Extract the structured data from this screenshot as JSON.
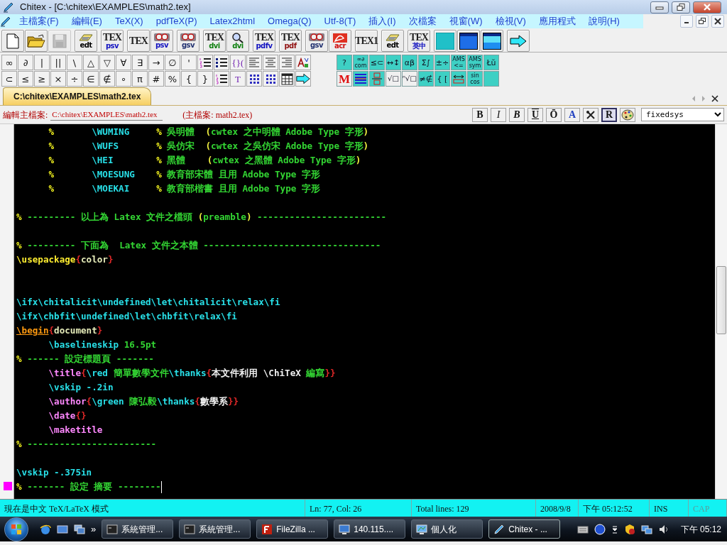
{
  "window": {
    "title": "Chitex - [C:\\chitex\\EXAMPLES\\math2.tex]"
  },
  "menu": [
    "主檔案(F)",
    "編輯(E)",
    "TeX(X)",
    "pdfTeX(P)",
    "Latex2html",
    "Omega(Q)",
    "Utf-8(T)",
    "插入(I)",
    "次檔案",
    "視窗(W)",
    "檢視(V)",
    "應用程式",
    "說明(H)"
  ],
  "toolbar": {
    "groups": [
      [
        {
          "kind": "new",
          "disabled": false
        },
        {
          "kind": "open",
          "disabled": false
        },
        {
          "kind": "save",
          "disabled": true
        }
      ],
      [
        {
          "kind": "notepad",
          "bottom": "edt",
          "color": "#000000",
          "disabled": false
        }
      ],
      [
        {
          "kind": "tex",
          "top": "TEX",
          "bottom": "psv",
          "color": "#1010c0",
          "disabled": false
        }
      ],
      [
        {
          "kind": "tex",
          "top": "TEX",
          "disabled": false
        },
        {
          "kind": "viewer",
          "bottom": "psv",
          "color": "#1010c0",
          "disabled": false
        }
      ],
      [
        {
          "kind": "viewer",
          "bottom": "gsv",
          "color": "#203070",
          "disabled": false
        }
      ],
      [
        {
          "kind": "tex",
          "top": "TEX",
          "bottom": "dvi",
          "color": "#108010",
          "disabled": false
        },
        {
          "kind": "magnifier",
          "bottom": "dvi",
          "color": "#108010",
          "disabled": false
        }
      ],
      [
        {
          "kind": "tex",
          "top": "TEX",
          "bottom": "pdfv",
          "color": "#1010c0",
          "disabled": false
        }
      ],
      [
        {
          "kind": "tex",
          "top": "TEX",
          "bottom": "pdf",
          "color": "#901010",
          "disabled": false
        }
      ],
      [
        {
          "kind": "viewer",
          "bottom": "gsv",
          "color": "#203070",
          "disabled": false
        },
        {
          "kind": "swirl",
          "bottom": "acr",
          "color": "#d01010",
          "disabled": false
        }
      ],
      [
        {
          "kind": "tex",
          "top": "TEX1",
          "disabled": false
        }
      ],
      [
        {
          "kind": "notepad",
          "bottom": "edt",
          "color": "#000000",
          "disabled": false
        }
      ],
      [
        {
          "kind": "tex",
          "top": "TEX",
          "bottom": "英中",
          "color": "#1010c0",
          "disabled": false
        }
      ],
      [
        {
          "kind": "square",
          "disabled": false
        },
        {
          "kind": "window",
          "disabled": false
        },
        {
          "kind": "window2",
          "disabled": false
        }
      ],
      [
        {
          "kind": "arrow",
          "disabled": false
        }
      ]
    ]
  },
  "symbols": {
    "rows": [
      [
        {
          "kind": "char",
          "text": "∞"
        },
        {
          "kind": "char",
          "text": "∂"
        },
        {
          "kind": "char",
          "text": "|"
        },
        {
          "kind": "char",
          "text": "||"
        },
        {
          "kind": "char",
          "text": "\\"
        },
        {
          "kind": "char",
          "text": "△"
        },
        {
          "kind": "char",
          "text": "▽"
        },
        {
          "kind": "char",
          "text": "∀"
        },
        {
          "kind": "char",
          "text": "∃"
        },
        {
          "kind": "char",
          "text": "→"
        },
        {
          "kind": "char",
          "text": "∅"
        },
        {
          "kind": "char",
          "text": "'"
        },
        {
          "kind": "numbered-list"
        },
        {
          "kind": "bullet-list"
        },
        {
          "kind": "bracket",
          "text": "{}("
        },
        {
          "kind": "align-left"
        },
        {
          "kind": "align-center"
        },
        {
          "kind": "align-right"
        },
        {
          "kind": "font-size"
        }
      ],
      [
        {
          "kind": "char",
          "text": "⊂"
        },
        {
          "kind": "char",
          "text": "≤"
        },
        {
          "kind": "char",
          "text": "≥"
        },
        {
          "kind": "char",
          "text": "×"
        },
        {
          "kind": "char",
          "text": "÷"
        },
        {
          "kind": "char",
          "text": "∈"
        },
        {
          "kind": "char",
          "text": "∉"
        },
        {
          "kind": "char",
          "text": "∘"
        },
        {
          "kind": "char",
          "text": "π"
        },
        {
          "kind": "char",
          "text": "#"
        },
        {
          "kind": "char",
          "text": "%"
        },
        {
          "kind": "char",
          "text": "{"
        },
        {
          "kind": "char",
          "text": "}"
        },
        {
          "kind": "numbered-list"
        },
        {
          "kind": "bracket",
          "text": "T"
        },
        {
          "kind": "grid"
        },
        {
          "kind": "grid"
        },
        {
          "kind": "table"
        },
        {
          "kind": "arrow"
        }
      ]
    ]
  },
  "math_palette": {
    "rows": [
      [
        {
          "kind": "math",
          "text": "?"
        },
        {
          "kind": "math",
          "lines": [
            "∞∂",
            "com"
          ]
        },
        {
          "kind": "math",
          "text": "≤⊂"
        },
        {
          "kind": "math",
          "text": "↔↕"
        },
        {
          "kind": "math",
          "text": "αβ"
        },
        {
          "kind": "math",
          "text": "Σ∫"
        },
        {
          "kind": "math",
          "text": "±÷"
        },
        {
          "kind": "math",
          "lines": [
            "AMS",
            "<="
          ]
        },
        {
          "kind": "math",
          "lines": [
            "AMS",
            "sym"
          ]
        },
        {
          "kind": "math",
          "text": "Łŭ"
        }
      ],
      [
        {
          "kind": "letter",
          "text": "M"
        },
        {
          "kind": "align-lines"
        },
        {
          "kind": "fraction"
        },
        {
          "kind": "plain",
          "text": "√□"
        },
        {
          "kind": "plain",
          "text": "ⁿ√□"
        },
        {
          "kind": "math",
          "text": "≠∉"
        },
        {
          "kind": "math",
          "text": "{ ["
        },
        {
          "kind": "hbox"
        },
        {
          "kind": "math",
          "lines": [
            "sin",
            "cos"
          ]
        },
        {
          "kind": "blank"
        }
      ]
    ]
  },
  "tabs": [
    {
      "label": "C:\\chitex\\EXAMPLES\\math2.tex",
      "selected": true
    }
  ],
  "file_bar": {
    "label": "編輯主檔案:",
    "path": "C:\\chitex\\EXAMPLES\\math2.tex",
    "main_file": "(主檔案: math2.tex)",
    "font": "fixedsys",
    "format_buttons": [
      {
        "kind": "bold",
        "text": "B",
        "pressed": false
      },
      {
        "kind": "italic",
        "text": "I",
        "pressed": false
      },
      {
        "kind": "bolditalic",
        "text": "B",
        "pressed": false
      },
      {
        "kind": "underline",
        "text": "U",
        "pressed": false
      },
      {
        "kind": "overline",
        "text": "Ō",
        "pressed": false
      },
      {
        "kind": "color",
        "text": "A",
        "pressed": false
      },
      {
        "kind": "tool",
        "pressed": false
      },
      {
        "kind": "raw",
        "text": "R",
        "pressed": true
      },
      {
        "kind": "palette",
        "pressed": false
      }
    ]
  },
  "editor": {
    "lines": [
      {
        "current": false,
        "segments": [
          {
            "kind": "pct",
            "text": "      %"
          },
          {
            "kind": "cmd",
            "text": "       \\WUMING"
          },
          {
            "kind": "pct",
            "text": "     %"
          },
          {
            "kind": "text",
            "text": " 吳明體  "
          },
          {
            "kind": "paren",
            "text": "("
          },
          {
            "kind": "text",
            "text": "cwtex 之中明體 Adobe Type 字形"
          },
          {
            "kind": "paren",
            "text": ")"
          }
        ]
      },
      {
        "current": false,
        "segments": [
          {
            "kind": "pct",
            "text": "      %"
          },
          {
            "kind": "cmd",
            "text": "       \\WUFS"
          },
          {
            "kind": "pct",
            "text": "       %"
          },
          {
            "kind": "text",
            "text": " 吳仿宋  "
          },
          {
            "kind": "paren",
            "text": "("
          },
          {
            "kind": "text",
            "text": "cwtex 之吳仿宋 Adobe Type 字形"
          },
          {
            "kind": "paren",
            "text": ")"
          }
        ]
      },
      {
        "current": false,
        "segments": [
          {
            "kind": "pct",
            "text": "      %"
          },
          {
            "kind": "cmd",
            "text": "       \\HEI"
          },
          {
            "kind": "pct",
            "text": "        %"
          },
          {
            "kind": "text",
            "text": " 黑體    "
          },
          {
            "kind": "paren",
            "text": "("
          },
          {
            "kind": "text",
            "text": "cwtex 之黑體 Adobe Type 字形"
          },
          {
            "kind": "paren",
            "text": ")"
          }
        ]
      },
      {
        "current": false,
        "segments": [
          {
            "kind": "pct",
            "text": "      %"
          },
          {
            "kind": "cmd",
            "text": "       \\MOESUNG"
          },
          {
            "kind": "pct",
            "text": "    %"
          },
          {
            "kind": "text",
            "text": " 教育部宋體 且用 Adobe Type 字形"
          }
        ]
      },
      {
        "current": false,
        "segments": [
          {
            "kind": "pct",
            "text": "      %"
          },
          {
            "kind": "cmd",
            "text": "       \\MOEKAI"
          },
          {
            "kind": "pct",
            "text": "     %"
          },
          {
            "kind": "text",
            "text": " 教育部楷書 且用 Adobe Type 字形"
          }
        ]
      },
      {
        "current": false
      },
      {
        "current": false,
        "segments": [
          {
            "kind": "pct",
            "text": "%"
          },
          {
            "kind": "text",
            "text": " --------- 以上為 Latex 文件之檔頭 "
          },
          {
            "kind": "paren",
            "text": "("
          },
          {
            "kind": "text",
            "text": "preamble"
          },
          {
            "kind": "paren",
            "text": ")"
          },
          {
            "kind": "text",
            "text": " ------------------------"
          }
        ]
      },
      {
        "current": false
      },
      {
        "current": false,
        "segments": [
          {
            "kind": "pct",
            "text": "%"
          },
          {
            "kind": "text",
            "text": " --------- 下面為  Latex 文件之本體 ---------------------------------"
          }
        ]
      },
      {
        "current": false,
        "segments": [
          {
            "kind": "pkg",
            "text": "\\usepackage"
          },
          {
            "kind": "brace",
            "text": "{"
          },
          {
            "kind": "arg",
            "text": "color"
          },
          {
            "kind": "brace",
            "text": "}"
          }
        ]
      },
      {
        "current": false
      },
      {
        "current": false
      },
      {
        "current": false,
        "segments": [
          {
            "kind": "cmd",
            "text": "\\ifx\\chitalicit\\undefined\\let\\chitalicit\\relax\\fi"
          }
        ]
      },
      {
        "current": false,
        "segments": [
          {
            "kind": "cmd",
            "text": "\\ifx\\chbfit\\undefined\\let\\chbfit\\relax\\fi"
          }
        ]
      },
      {
        "current": false,
        "segments": [
          {
            "kind": "begin",
            "text": "\\begin"
          },
          {
            "kind": "brace",
            "text": "{"
          },
          {
            "kind": "arg",
            "text": "document"
          },
          {
            "kind": "brace",
            "text": "}"
          }
        ]
      },
      {
        "current": false,
        "segments": [
          {
            "kind": "cmd",
            "text": "      \\baselineskip"
          },
          {
            "kind": "text",
            "text": " 16.5pt"
          }
        ]
      },
      {
        "current": false,
        "segments": [
          {
            "kind": "pct",
            "text": "%"
          },
          {
            "kind": "text",
            "text": " ------ 設定標題頁 -------"
          }
        ]
      },
      {
        "current": false,
        "segments": [
          {
            "kind": "macro",
            "text": "      \\title"
          },
          {
            "kind": "brace",
            "text": "{"
          },
          {
            "kind": "cmd",
            "text": "\\red"
          },
          {
            "kind": "text",
            "text": " 簡單數學文件"
          },
          {
            "kind": "cmd",
            "text": "\\thanks"
          },
          {
            "kind": "brace",
            "text": "{"
          },
          {
            "kind": "plain",
            "text": "本文件利用 \\ChiTeX"
          },
          {
            "kind": "text",
            "text": " 編寫"
          },
          {
            "kind": "brace",
            "text": "}}"
          }
        ]
      },
      {
        "current": false,
        "segments": [
          {
            "kind": "cmd",
            "text": "      \\vskip -.2in"
          }
        ]
      },
      {
        "current": false,
        "segments": [
          {
            "kind": "macro",
            "text": "      \\author"
          },
          {
            "kind": "brace",
            "text": "{"
          },
          {
            "kind": "cmd",
            "text": "\\green"
          },
          {
            "kind": "text",
            "text": " 陳弘毅"
          },
          {
            "kind": "cmd",
            "text": "\\thanks"
          },
          {
            "kind": "brace",
            "text": "{"
          },
          {
            "kind": "plain",
            "text": "數學系"
          },
          {
            "kind": "brace",
            "text": "}}"
          }
        ]
      },
      {
        "current": false,
        "segments": [
          {
            "kind": "macro",
            "text": "      \\date"
          },
          {
            "kind": "brace",
            "text": "{}"
          }
        ]
      },
      {
        "current": false,
        "segments": [
          {
            "kind": "macro",
            "text": "      \\maketitle"
          }
        ]
      },
      {
        "current": false,
        "segments": [
          {
            "kind": "pct",
            "text": "%"
          },
          {
            "kind": "text",
            "text": " ------------------------"
          }
        ]
      },
      {
        "current": false
      },
      {
        "current": false,
        "segments": [
          {
            "kind": "cmd",
            "text": "\\vskip -.375in"
          }
        ]
      },
      {
        "current": true,
        "segments": [
          {
            "kind": "pct",
            "text": "%"
          },
          {
            "kind": "text",
            "text": " ------- 設定 摘要 --------"
          }
        ]
      }
    ]
  },
  "status_bar": [
    {
      "text": "現在是中文 TeX/LaTeX  模式",
      "disabled": false
    },
    {
      "text": "Ln: 77, Col: 26",
      "disabled": false
    },
    {
      "text": "Total lines: 129",
      "disabled": false
    },
    {
      "text": "2008/9/8",
      "disabled": false
    },
    {
      "text": "下午 05:12:52",
      "disabled": false
    },
    {
      "text": "INS",
      "disabled": false
    },
    {
      "text": "CAP",
      "disabled": true
    }
  ],
  "taskbar": {
    "overflow": "»",
    "tasks": [
      {
        "kind": "console",
        "label": "系統管理...",
        "selected": false
      },
      {
        "kind": "console",
        "label": "系統管理...",
        "selected": false
      },
      {
        "kind": "app",
        "label": "FileZilla ...",
        "selected": false
      },
      {
        "kind": "remote",
        "label": "140.115....",
        "selected": false
      },
      {
        "kind": "monitor",
        "label": "個人化",
        "selected": false
      },
      {
        "kind": "pen",
        "label": "Chitex - ...",
        "selected": true
      }
    ],
    "clock": "下午 05:12"
  }
}
